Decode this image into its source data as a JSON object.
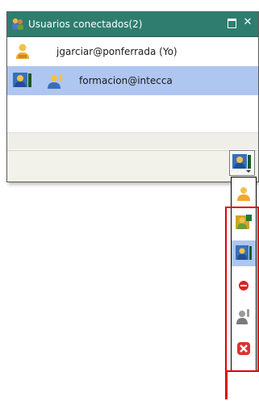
{
  "window": {
    "title": "Usuarios conectados(2)",
    "maximize_label": "",
    "close_label": "✕"
  },
  "users": [
    {
      "label": "jgarciar@ponferrada (Yo)",
      "selected": false
    },
    {
      "label": "formacion@intecca",
      "selected": true
    }
  ],
  "status_menu": {
    "items": [
      {
        "icon": "user-available-icon"
      },
      {
        "icon": "user-busy-icon"
      },
      {
        "icon": "user-presenting-icon",
        "active": true
      },
      {
        "icon": "do-not-disturb-icon"
      },
      {
        "icon": "user-away-icon"
      },
      {
        "icon": "disconnect-icon"
      }
    ]
  },
  "colors": {
    "titlebar": "#2f7d6f",
    "selection": "#aec6f0",
    "highlight_box": "#e00000"
  }
}
